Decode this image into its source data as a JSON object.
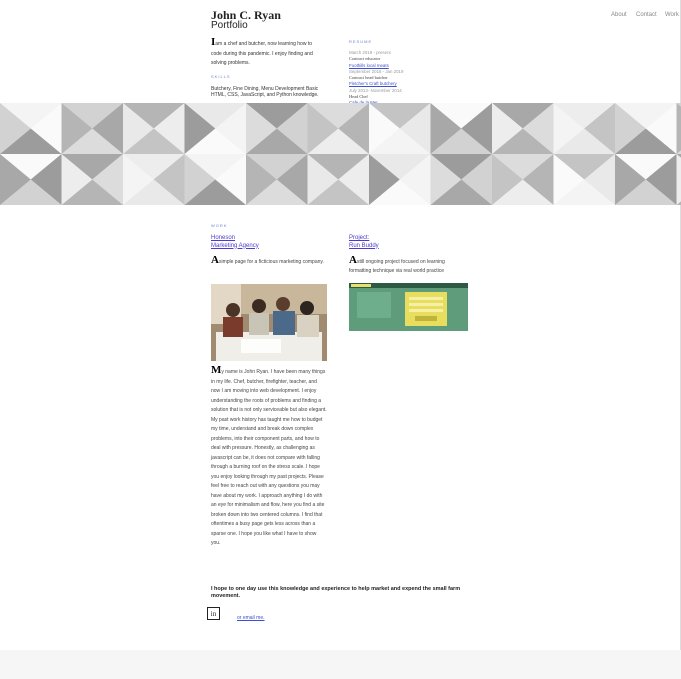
{
  "header": {
    "name": "John C. Ryan",
    "subtitle": "Portfolio"
  },
  "nav": {
    "about": "About",
    "contact": "Contact",
    "work": "Work"
  },
  "intro": {
    "initial": "I",
    "text": "am a chef and butcher, now learning how to code during this pandemic. I enjoy finding and solving problems."
  },
  "skills": {
    "heading": "SKILLS",
    "text": "Butchery, Fine Dining, Menu Development Basic HTML, CSS, JavaScript, and Python knowledge."
  },
  "resume": {
    "heading": "RESUME",
    "entries": [
      {
        "date": "March 2019 - present",
        "title": "Contract educator",
        "link": "Foothills local meats"
      },
      {
        "date": "September 2015 - Jan 2019",
        "title": "Contract head butcher",
        "link": "Fletcher's Craft butchery"
      },
      {
        "date": "July 2013- November 2014",
        "title": "Head Chef",
        "link": "Cafe de la Mer"
      }
    ]
  },
  "work": {
    "heading": "WORK",
    "left": {
      "line1": "Honeson",
      "line2": "Marketing Agency",
      "initial": "A",
      "desc": "simple page for a ficticious marketing company."
    },
    "right": {
      "line1": "Project:",
      "line2": "Run Buddy",
      "initial": "A",
      "desc": "still ongoing project focused on learning formatting technique via real world practice"
    },
    "shot_text": "Run Buddy"
  },
  "bio": {
    "initial": "M",
    "text": "y name is John Ryan. I have been many things in my life. Chef, butcher, firefighter, teacher, and now I am moving into web development. I enjoy understanding the roots of problems and finding a solution that is not only serviceable but also elegant. My past work history has taught me how to budget my time, understand and break down complex problems, into their component parts, and how to deal with pressure. Honestly, as challenging as javascript can be, it does not compare with falling through a burning roof on the stress scale. I hope you enjoy looking through my past projects. Please feel free to reach out with any questions you may have about my work. I approach anything I do with an eye for minimalism and flow, here you find a site broken down into two centered columns. I find that oftentimes a busy page gets less across than a sparse one. I hope you like what I have to show you."
  },
  "closing": {
    "text": "I hope to one day use this knowledge and experience to help market and expend the small farm movement.",
    "email_label": "or email me.",
    "logo_label": "in"
  },
  "colors": {
    "accent": "#6a7fd1",
    "link": "#3b4fd0",
    "work_link": "#4a3ad0"
  }
}
